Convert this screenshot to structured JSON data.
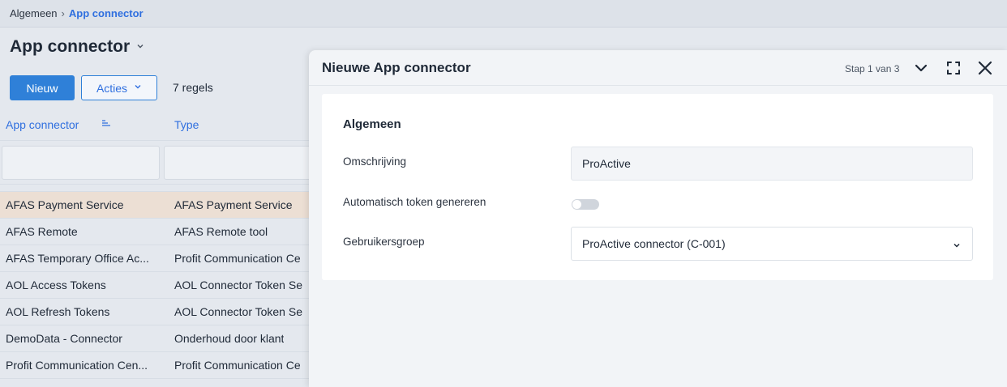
{
  "breadcrumb": {
    "parent": "Algemeen",
    "separator": "›",
    "current": "App connector"
  },
  "page": {
    "title": "App connector"
  },
  "toolbar": {
    "new_label": "Nieuw",
    "actions_label": "Acties",
    "row_count": "7 regels"
  },
  "table": {
    "columns": [
      "App connector",
      "Type"
    ],
    "rows": [
      {
        "name": "AFAS Payment Service",
        "type": "AFAS Payment Service",
        "selected": true
      },
      {
        "name": "AFAS Remote",
        "type": "AFAS Remote tool"
      },
      {
        "name": "AFAS Temporary Office Ac...",
        "type": "Profit Communication Ce"
      },
      {
        "name": "AOL Access Tokens",
        "type": "AOL Connector Token Se"
      },
      {
        "name": "AOL Refresh Tokens",
        "type": "AOL Connector Token Se"
      },
      {
        "name": "DemoData - Connector",
        "type": "Onderhoud door klant"
      },
      {
        "name": "Profit Communication Cen...",
        "type": "Profit Communication Ce"
      }
    ]
  },
  "dialog": {
    "title": "Nieuwe App connector",
    "step": "Stap 1 van 3",
    "section_title": "Algemeen",
    "fields": {
      "description_label": "Omschrijving",
      "description_value": "ProActive",
      "auto_token_label": "Automatisch token genereren",
      "auto_token_on": false,
      "user_group_label": "Gebruikersgroep",
      "user_group_value": "ProActive connector (C-001)"
    }
  },
  "colors": {
    "accent": "#2f80d8",
    "link": "#2f6fdf",
    "selected_row": "#ecdfd4"
  }
}
